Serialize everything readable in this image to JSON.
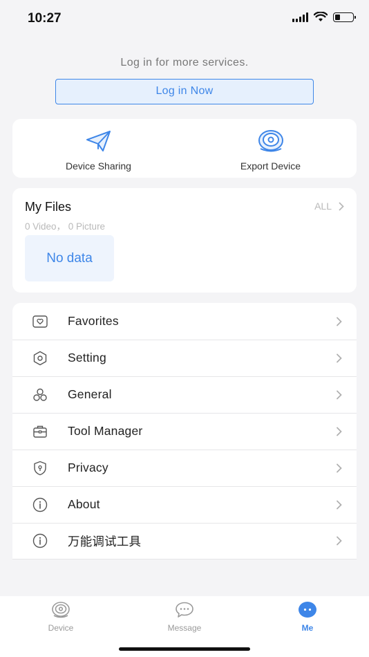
{
  "status_bar": {
    "time": "10:27"
  },
  "login": {
    "prompt": "Log in for more services.",
    "button_label": "Log in Now"
  },
  "quick_actions": [
    {
      "label": "Device Sharing",
      "icon": "paper-plane-icon"
    },
    {
      "label": "Export Device",
      "icon": "camera-device-icon"
    }
  ],
  "my_files": {
    "title": "My Files",
    "all_label": "ALL",
    "summary": "0 Video， 0 Picture",
    "empty_label": "No data"
  },
  "menu": [
    {
      "label": "Favorites",
      "icon": "favorites-icon"
    },
    {
      "label": "Setting",
      "icon": "setting-hexagon-icon"
    },
    {
      "label": "General",
      "icon": "general-circles-icon"
    },
    {
      "label": "Tool Manager",
      "icon": "toolbox-icon"
    },
    {
      "label": "Privacy",
      "icon": "shield-lock-icon"
    },
    {
      "label": "About",
      "icon": "info-icon"
    },
    {
      "label": "万能调试工具",
      "icon": "info-icon"
    }
  ],
  "tabs": [
    {
      "label": "Device",
      "icon": "device-camera-icon",
      "active": false
    },
    {
      "label": "Message",
      "icon": "message-bubble-icon",
      "active": false
    },
    {
      "label": "Me",
      "icon": "me-face-icon",
      "active": true
    }
  ],
  "colors": {
    "accent": "#3e86e8",
    "background": "#f4f4f6",
    "card": "#ffffff",
    "muted_text": "#b9b9b9"
  }
}
